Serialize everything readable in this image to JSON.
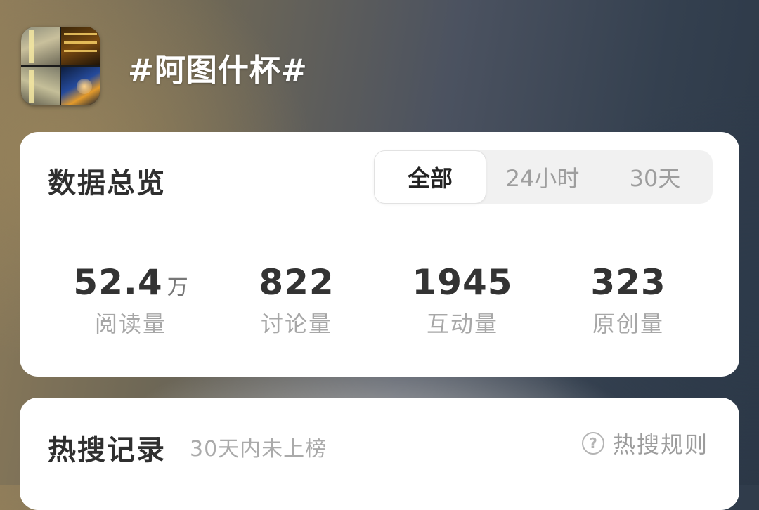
{
  "topic": {
    "title": "#阿图什杯#",
    "cover_icon": "topic-cover-collage"
  },
  "overview": {
    "title": "数据总览",
    "tabs": [
      {
        "label": "全部",
        "active": true
      },
      {
        "label": "24小时",
        "active": false
      },
      {
        "label": "30天",
        "active": false
      }
    ],
    "stats": [
      {
        "value": "52.4",
        "unit": "万",
        "label": "阅读量"
      },
      {
        "value": "822",
        "unit": "",
        "label": "讨论量"
      },
      {
        "value": "1945",
        "unit": "",
        "label": "互动量"
      },
      {
        "value": "323",
        "unit": "",
        "label": "原创量"
      }
    ]
  },
  "hot_search": {
    "title": "热搜记录",
    "subtitle": "30天内未上榜",
    "rules_label": "热搜规则",
    "rules_icon": "?"
  },
  "colors": {
    "card": "#ffffff",
    "text_primary": "#333333",
    "text_secondary": "#a7a7a7"
  }
}
